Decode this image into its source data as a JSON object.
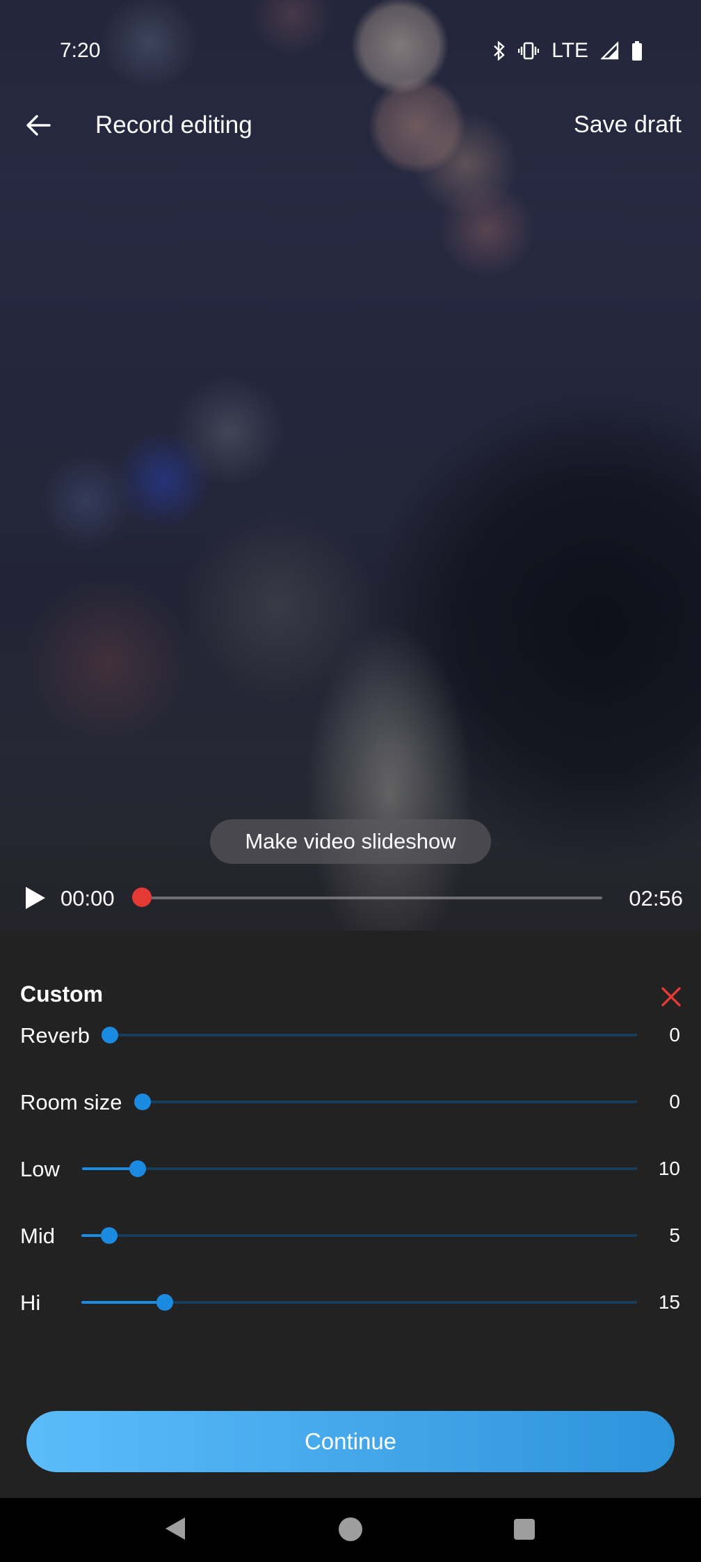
{
  "status_bar": {
    "time": "7:20",
    "network": "LTE",
    "icons": [
      "bluetooth-icon",
      "vibrate-icon",
      "signal-icon",
      "battery-icon"
    ]
  },
  "app_bar": {
    "back_icon": "arrow-back-icon",
    "title": "Record editing",
    "save_draft": "Save draft"
  },
  "preview": {
    "slideshow_label": "Make video slideshow",
    "current_time": "00:00",
    "total_time": "02:56",
    "progress": 0,
    "accent_color": "#e53935"
  },
  "panel": {
    "title": "Custom",
    "close_icon": "close-icon",
    "close_color": "#e53935",
    "slider_color": "#1a8be0",
    "sliders": [
      {
        "label": "Reverb",
        "value": "0",
        "fraction": 0.0
      },
      {
        "label": "Room size",
        "value": "0",
        "fraction": 0.0
      },
      {
        "label": "Low",
        "value": "10",
        "fraction": 0.1
      },
      {
        "label": "Mid",
        "value": "5",
        "fraction": 0.05
      },
      {
        "label": "Hi",
        "value": "15",
        "fraction": 0.15
      }
    ],
    "continue_label": "Continue"
  },
  "nav_bar": {
    "icons": [
      "nav-back-icon",
      "nav-home-icon",
      "nav-recents-icon"
    ]
  }
}
